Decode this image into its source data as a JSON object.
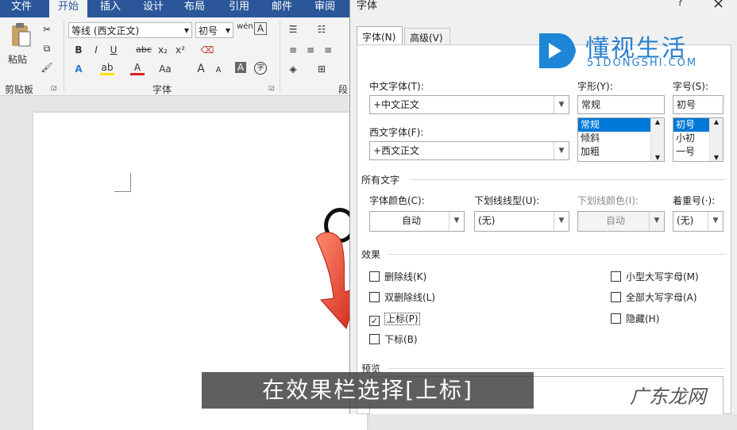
{
  "ribbon": {
    "tabs": [
      "文件",
      "开始",
      "插入",
      "设计",
      "布局",
      "引用",
      "邮件",
      "审阅"
    ],
    "active_tab": "开始",
    "paste_label": "粘贴",
    "clipboard_group": "剪贴板",
    "font_group": "字体",
    "paragraph_group_partial": "段",
    "font_name": "等线 (西文正文)",
    "font_size": "初号",
    "wen_glyph": "wén",
    "bold": "B",
    "italic": "I",
    "underline": "U",
    "strike": "abc",
    "subscript": "x₂",
    "superscript": "x²",
    "grow": "A",
    "shrink": "A",
    "case": "Aa",
    "char_border": "A",
    "enclose": "字"
  },
  "dialog": {
    "title": "字体",
    "help": "?",
    "close": "×",
    "tabs": [
      "字体(N)",
      "高级(V)"
    ],
    "chinese_font_label": "中文字体(T):",
    "chinese_font_value": "+中文正文",
    "western_font_label": "西文字体(F):",
    "western_font_value": "+西文正文",
    "style_label": "字形(Y):",
    "style_value": "常规",
    "style_options": [
      "常规",
      "倾斜",
      "加粗"
    ],
    "size_label": "字号(S):",
    "size_value": "初号",
    "size_options": [
      "初号",
      "小初",
      "一号"
    ],
    "all_text_label": "所有文字",
    "font_color_label": "字体颜色(C):",
    "font_color_value": "自动",
    "underline_type_label": "下划线线型(U):",
    "underline_type_value": "(无)",
    "underline_color_label": "下划线颜色(I):",
    "underline_color_value": "自动",
    "emphasis_label": "着重号(·):",
    "emphasis_value": "(无)",
    "effects_label": "效果",
    "effects": {
      "strikethrough": "删除线(K)",
      "double_strikethrough": "双删除线(L)",
      "superscript": "上标(P)",
      "subscript": "下标(B)",
      "small_caps": "小型大写字母(M)",
      "all_caps": "全部大写字母(A)",
      "hidden": "隐藏(H)"
    },
    "superscript_checked": "✓",
    "preview_label": "预览"
  },
  "watermark": {
    "brand": "懂视生活",
    "domain": "51DONGSHI.COM",
    "bottom_brand": "广东龙网"
  },
  "caption": "在效果栏选择[上标]",
  "colors": {
    "ribbon_blue": "#2b579a",
    "select_blue": "#0078d7",
    "arrow_red": "#e0331c",
    "logo_blue": "#1d86d6"
  }
}
